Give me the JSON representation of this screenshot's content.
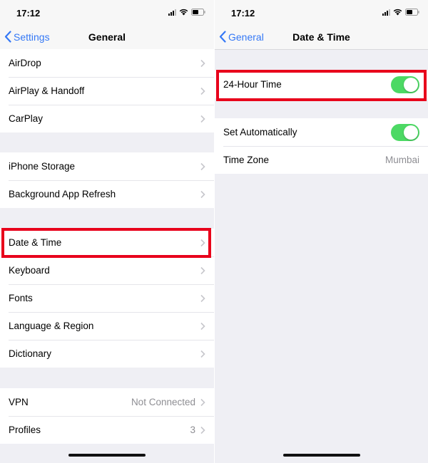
{
  "left": {
    "status": {
      "time": "17:12"
    },
    "nav": {
      "back_label": "Settings",
      "title": "General"
    },
    "groups": [
      [
        {
          "label": "AirDrop"
        },
        {
          "label": "AirPlay & Handoff"
        },
        {
          "label": "CarPlay"
        }
      ],
      [
        {
          "label": "iPhone Storage"
        },
        {
          "label": "Background App Refresh"
        }
      ],
      [
        {
          "label": "Date & Time"
        },
        {
          "label": "Keyboard"
        },
        {
          "label": "Fonts"
        },
        {
          "label": "Language & Region"
        },
        {
          "label": "Dictionary"
        }
      ],
      [
        {
          "label": "VPN",
          "value": "Not Connected"
        },
        {
          "label": "Profiles",
          "value": "3"
        }
      ]
    ]
  },
  "right": {
    "status": {
      "time": "17:12"
    },
    "nav": {
      "back_label": "General",
      "title": "Date & Time"
    },
    "groups": [
      [
        {
          "label": "24-Hour Time",
          "toggle": true
        }
      ],
      [
        {
          "label": "Set Automatically",
          "toggle": true
        },
        {
          "label": "Time Zone",
          "value": "Mumbai"
        }
      ]
    ]
  },
  "colors": {
    "accent": "#3478f6",
    "toggle_on": "#4cd964",
    "highlight": "#e8001b"
  }
}
